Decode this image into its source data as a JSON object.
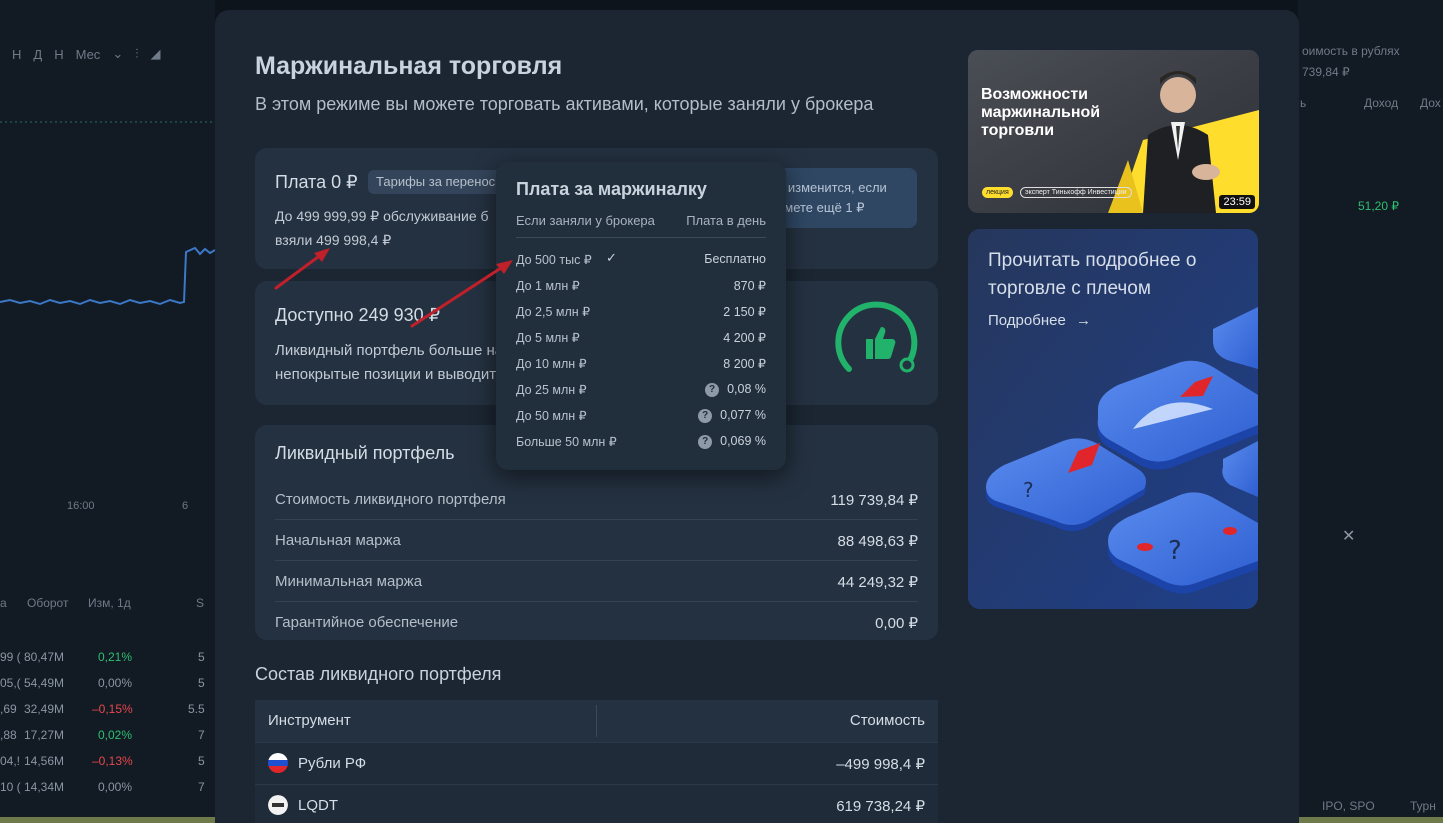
{
  "background": {
    "toolbar": [
      "Н",
      "Д",
      "Н",
      "Мес"
    ],
    "axis": [
      "16:00",
      "6"
    ],
    "table_head": [
      "а",
      "Оборот",
      "Изм, 1д",
      "S"
    ],
    "rows": [
      {
        "a": "99 (",
        "b": "80,47M",
        "c": "0,21%",
        "d": "5",
        "trend": "pos"
      },
      {
        "a": "05,(",
        "b": "54,49M",
        "c": "0,00%",
        "d": "5",
        "trend": "zero"
      },
      {
        "a": ",69",
        "b": "32,49M",
        "c": "–0,15%",
        "d": "5.5",
        "trend": "neg"
      },
      {
        "a": ",88",
        "b": "17,27M",
        "c": "0,02%",
        "d": "7",
        "trend": "pos"
      },
      {
        "a": "04,!",
        "b": "14,56M",
        "c": "–0,13%",
        "d": "5",
        "trend": "neg"
      },
      {
        "a": "10 (",
        "b": "14,34M",
        "c": "0,00%",
        "d": "7",
        "trend": "zero"
      }
    ],
    "right": {
      "header": "оимость в рублях",
      "value": "739,84 ₽",
      "col1": "ь",
      "col2": "Доход",
      "col3": "Дох",
      "income": "51,20 ₽",
      "footer_ipo": "IPO, SPO",
      "footer_tour": "Турн"
    }
  },
  "modal": {
    "title": "Маржинальная торговля",
    "subtitle": "В этом режиме вы можете торговать активами, которые заняли у брокера",
    "fee": {
      "title": "Плата 0 ₽",
      "tag": "Тарифы за перенос",
      "text_line1": "До 499 999,99 ₽ обслуживание б",
      "text_line2": "взяли 499 998,4 ₽",
      "note_line1": "е изменится, если",
      "note_line2": "имете ещё 1 ₽"
    },
    "available": {
      "title": "Доступно 249 930 ₽",
      "text_line1": "Ликвидный портфель больше на",
      "text_line2": "непокрытые позиции и выводит"
    },
    "liquid": {
      "title": "Ликвидный портфель",
      "rows": [
        {
          "label": "Стоимость ликвидного портфеля",
          "value": "119 739,84 ₽"
        },
        {
          "label": "Начальная маржа",
          "value": "88 498,63 ₽"
        },
        {
          "label": "Минимальная маржа",
          "value": "44 249,32 ₽"
        },
        {
          "label": "Гарантийное обеспечение",
          "value": "0,00 ₽"
        }
      ]
    },
    "composition": {
      "title": "Состав ликвидного портфеля",
      "col_instrument": "Инструмент",
      "col_value": "Стоимость",
      "rows": [
        {
          "name": "Рубли РФ",
          "value": "–499 998,4 ₽"
        },
        {
          "name": "LQDT",
          "value": "619 738,24 ₽"
        }
      ]
    },
    "video": {
      "title": "Возможности маржинальной торговли",
      "tag1": "лекция",
      "tag2": "эксперт Тинькофф Инвестиции",
      "duration": "23:59"
    },
    "read": {
      "title": "Прочитать подробнее о торговле с плечом",
      "link": "Подробнее",
      "link_arrow": "→"
    }
  },
  "popover": {
    "title": "Плата за маржиналку",
    "col_borrowed": "Если заняли у брокера",
    "col_fee": "Плата в день",
    "rows": [
      {
        "label": "До 500 тыс ₽",
        "value": "Бесплатно",
        "check": "✓",
        "help": false
      },
      {
        "label": "До 1 млн ₽",
        "value": "870 ₽",
        "check": "",
        "help": false
      },
      {
        "label": "До 2,5 млн ₽",
        "value": "2 150 ₽",
        "check": "",
        "help": false
      },
      {
        "label": "До 5 млн ₽",
        "value": "4 200 ₽",
        "check": "",
        "help": false
      },
      {
        "label": "До 10 млн ₽",
        "value": "8 200 ₽",
        "check": "",
        "help": false
      },
      {
        "label": "До 25 млн ₽",
        "value": "0,08 %",
        "check": "",
        "help": true
      },
      {
        "label": "До 50 млн ₽",
        "value": "0,077 %",
        "check": "",
        "help": true
      },
      {
        "label": "Больше 50 млн ₽",
        "value": "0,069 %",
        "check": "",
        "help": true
      }
    ]
  },
  "colors": {
    "positive": "#2fbf71",
    "negative": "#e5484d",
    "annotation_arrow": "#c0202a",
    "gauge": "#21b26b"
  }
}
